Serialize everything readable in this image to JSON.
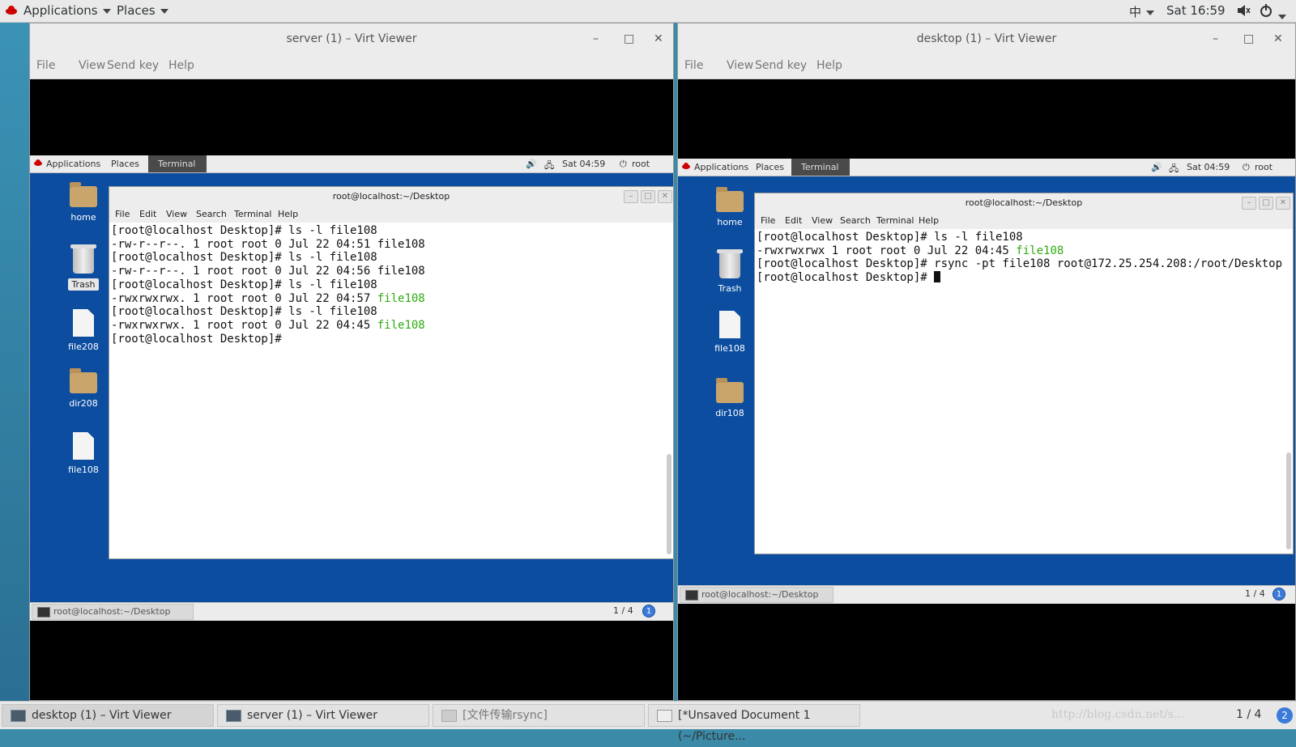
{
  "host": {
    "topbar": {
      "applications": "Applications",
      "places": "Places",
      "input_method": "中",
      "clock": "Sat 16:59"
    },
    "taskbar": [
      {
        "label": "desktop (1) – Virt Viewer"
      },
      {
        "label": "server (1) – Virt Viewer"
      },
      {
        "label": "[文件传输rsync]"
      },
      {
        "label": "[*Unsaved Document 1 (~/Picture..."
      }
    ],
    "workspace": "1 / 4",
    "workspace_badge": "2",
    "watermark": "http://blog.csdn.net/s..."
  },
  "server_viewer": {
    "title": "server (1) – Virt Viewer",
    "menu": [
      "File",
      "View",
      "Send key",
      "Help"
    ],
    "guest": {
      "topbar": {
        "applications": "Applications",
        "places": "Places",
        "terminal": "Terminal",
        "clock": "Sat 04:59",
        "user": "root"
      },
      "icons": [
        {
          "label": "home",
          "type": "folder-home"
        },
        {
          "label": "Trash",
          "type": "trash"
        },
        {
          "label": "file208",
          "type": "file"
        },
        {
          "label": "dir208",
          "type": "folder"
        },
        {
          "label": "file108",
          "type": "file"
        }
      ],
      "terminal": {
        "title": "root@localhost:~/Desktop",
        "menu": [
          "File",
          "Edit",
          "View",
          "Search",
          "Terminal",
          "Help"
        ],
        "lines": [
          {
            "text": "[root@localhost Desktop]# ls -l file108",
            "green": ""
          },
          {
            "text": "-rw-r--r--. 1 root root 0 Jul 22 04:51 file108",
            "green": ""
          },
          {
            "text": "[root@localhost Desktop]# ls -l file108",
            "green": ""
          },
          {
            "text": "-rw-r--r--. 1 root root 0 Jul 22 04:56 file108",
            "green": ""
          },
          {
            "text": "[root@localhost Desktop]# ls -l file108",
            "green": ""
          },
          {
            "text": "-rwxrwxrwx. 1 root root 0 Jul 22 04:57 ",
            "green": "file108"
          },
          {
            "text": "[root@localhost Desktop]# ls -l file108",
            "green": ""
          },
          {
            "text": "-rwxrwxrwx. 1 root root 0 Jul 22 04:45 ",
            "green": "file108"
          },
          {
            "text": "[root@localhost Desktop]# ",
            "green": ""
          }
        ]
      },
      "taskbar_item": "root@localhost:~/Desktop",
      "workspace": "1 / 4",
      "badge": "1"
    }
  },
  "desktop_viewer": {
    "title": "desktop (1) – Virt Viewer",
    "menu": [
      "File",
      "View",
      "Send key",
      "Help"
    ],
    "guest": {
      "topbar": {
        "applications": "Applications",
        "places": "Places",
        "terminal": "Terminal",
        "clock": "Sat 04:59",
        "user": "root"
      },
      "icons": [
        {
          "label": "home",
          "type": "folder-home"
        },
        {
          "label": "Trash",
          "type": "trash"
        },
        {
          "label": "file108",
          "type": "file"
        },
        {
          "label": "dir108",
          "type": "folder"
        }
      ],
      "terminal": {
        "title": "root@localhost:~/Desktop",
        "menu": [
          "File",
          "Edit",
          "View",
          "Search",
          "Terminal",
          "Help"
        ],
        "lines": [
          {
            "text": "[root@localhost Desktop]# ls -l file108",
            "green": ""
          },
          {
            "text": "-rwxrwxrwx 1 root root 0 Jul 22 04:45 ",
            "green": "file108"
          },
          {
            "text": "[root@localhost Desktop]# rsync -pt file108 root@172.25.254.208:/root/Desktop",
            "green": ""
          },
          {
            "text": "[root@localhost Desktop]# ",
            "green": "",
            "cursor": true
          }
        ]
      },
      "taskbar_item": "root@localhost:~/Desktop",
      "workspace": "1 / 4",
      "badge": "1"
    }
  }
}
